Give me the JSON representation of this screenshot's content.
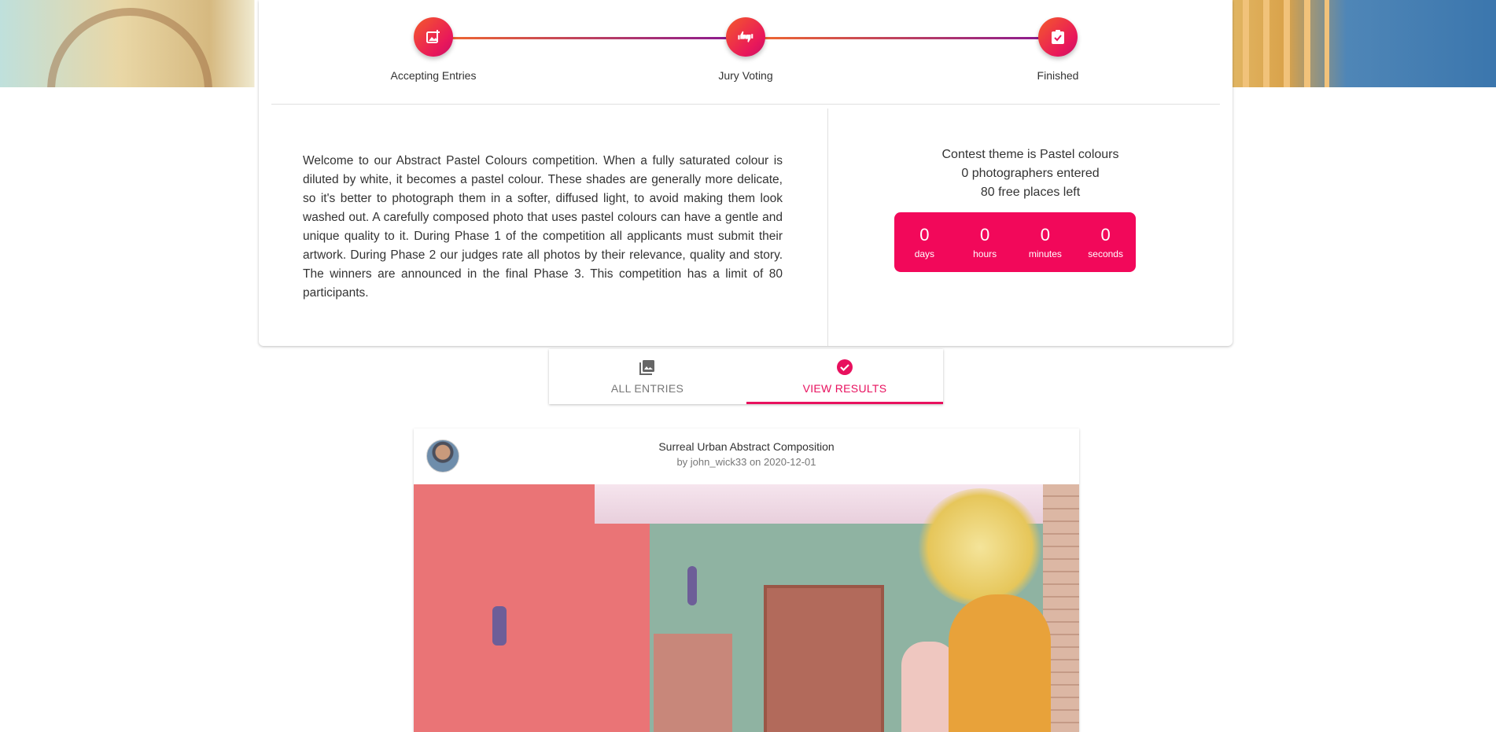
{
  "stepper": {
    "steps": [
      {
        "label": "Accepting Entries",
        "icon": "add-photo-icon"
      },
      {
        "label": "Jury Voting",
        "icon": "thumbs-up-down-icon"
      },
      {
        "label": "Finished",
        "icon": "assignment-check-icon"
      }
    ]
  },
  "description": "Welcome to our Abstract Pastel Colours competition. When a fully saturated colour is diluted by white, it becomes a pastel colour. These shades are generally more delicate, so it's better to photograph them in a softer, diffused light, to avoid making them look washed out. A carefully composed photo that uses pastel colours can have a gentle and unique quality to it. During Phase 1 of the competition all applicants must submit their artwork. During Phase 2 our judges rate all photos by their relevance, quality and story. The winners are announced in the final Phase 3. This competition has a limit of 80 participants.",
  "stats": {
    "theme": "Contest theme is Pastel colours",
    "entered": "0 photographers entered",
    "places": "80 free places left"
  },
  "countdown": [
    {
      "value": "0",
      "label": "days"
    },
    {
      "value": "0",
      "label": "hours"
    },
    {
      "value": "0",
      "label": "minutes"
    },
    {
      "value": "0",
      "label": "seconds"
    }
  ],
  "tabs": [
    {
      "label": "ALL ENTRIES",
      "icon": "photo-library-icon",
      "active": false
    },
    {
      "label": "VIEW RESULTS",
      "icon": "check-circle-icon",
      "active": true
    }
  ],
  "post": {
    "title": "Surreal Urban Abstract Composition",
    "byline": "by john_wick33 on 2020-12-01"
  },
  "colors": {
    "accent": "#e8105e",
    "gradient_start": "#f36a2c",
    "gradient_end": "#8c1b8f"
  }
}
